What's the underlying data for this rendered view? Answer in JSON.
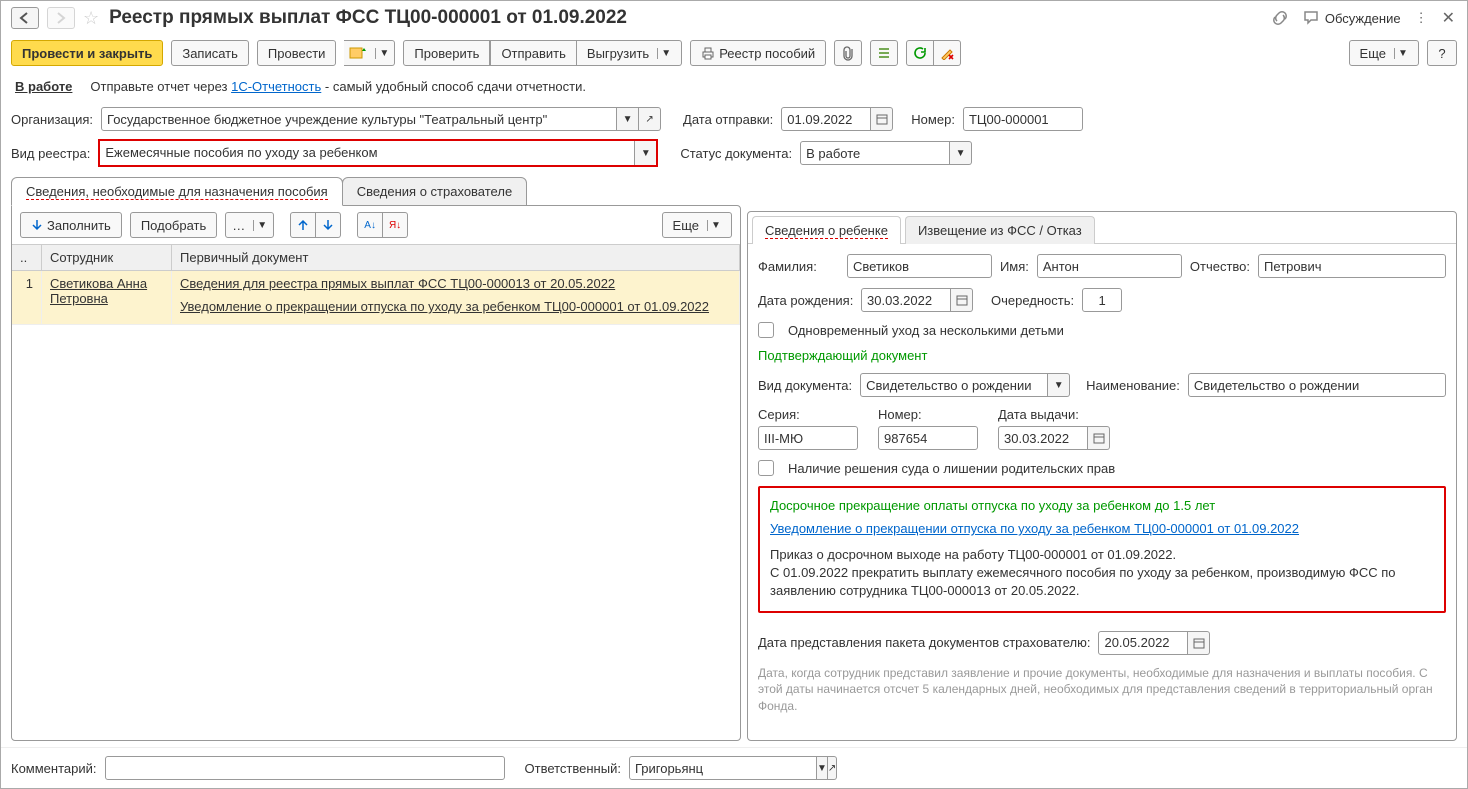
{
  "header": {
    "title": "Реестр прямых выплат ФСС ТЦ00-000001 от 01.09.2022",
    "discuss": "Обсуждение"
  },
  "toolbar": {
    "post_close": "Провести и закрыть",
    "save": "Записать",
    "post": "Провести",
    "check": "Проверить",
    "send": "Отправить",
    "upload": "Выгрузить",
    "registry": "Реестр пособий",
    "more": "Еще"
  },
  "status": {
    "state": "В работе",
    "hint_pre": "Отправьте отчет через ",
    "hint_link": "1С-Отчетность",
    "hint_post": " - самый удобный способ сдачи отчетности."
  },
  "form": {
    "org_label": "Организация:",
    "org_value": "Государственное бюджетное учреждение культуры \"Театральный центр\"",
    "send_date_label": "Дата отправки:",
    "send_date": "01.09.2022",
    "number_label": "Номер:",
    "number": "ТЦ00-000001",
    "kind_label": "Вид реестра:",
    "kind_value": "Ежемесячные пособия по уходу за ребенком",
    "doc_status_label": "Статус документа:",
    "doc_status": "В работе"
  },
  "tabs": {
    "t1": "Сведения, необходимые для назначения пособия",
    "t2": "Сведения о страхователе"
  },
  "sub_toolbar": {
    "fill": "Заполнить",
    "pick": "Подобрать",
    "more": "Еще"
  },
  "table": {
    "h1": "..",
    "h2": "Сотрудник",
    "h3": "Первичный документ",
    "row": {
      "n": "1",
      "emp": "Светикова Анна Петровна",
      "doc1": "Сведения для реестра прямых выплат ФСС ТЦ00-000013 от 20.05.2022",
      "doc2": "Уведомление о прекращении отпуска по уходу за ребенком ТЦ00-000001 от 01.09.2022"
    }
  },
  "rtabs": {
    "t1": "Сведения о ребенке",
    "t2": "Извещение из ФСС / Отказ"
  },
  "child": {
    "lastname_l": "Фамилия:",
    "lastname": "Светиков",
    "firstname_l": "Имя:",
    "firstname": "Антон",
    "midname_l": "Отчество:",
    "midname": "Петрович",
    "bdate_l": "Дата рождения:",
    "bdate": "30.03.2022",
    "order_l": "Очередность:",
    "order": "1",
    "multi": "Одновременный уход за несколькими детьми",
    "confirm_section": "Подтверждающий документ",
    "doctype_l": "Вид документа:",
    "doctype": "Свидетельство о рождении",
    "docname_l": "Наименование:",
    "docname": "Свидетельство о рождении",
    "series_l": "Серия:",
    "series": "III-МЮ",
    "dnum_l": "Номер:",
    "dnum": "987654",
    "ddate_l": "Дата выдачи:",
    "ddate": "30.03.2022",
    "court": "Наличие решения суда о лишении родительских прав",
    "early_title": "Досрочное прекращение оплаты отпуска по уходу за ребенком до 1.5 лет",
    "early_link": "Уведомление о прекращении отпуска по уходу за ребенком ТЦ00-000001 от 01.09.2022",
    "order_text1": "Приказ о досрочном выходе на работу ТЦ00-000001 от 01.09.2022.",
    "order_text2": "С 01.09.2022 прекратить выплату ежемесячного пособия по уходу за ребенком, производимую ФСС по заявлению сотрудника ТЦ00-000013 от 20.05.2022.",
    "pack_date_l": "Дата представления пакета документов страхователю:",
    "pack_date": "20.05.2022",
    "pack_hint": "Дата, когда сотрудник представил заявление и прочие документы, необходимые для назначения и выплаты пособия. С этой даты начинается отсчет 5 календарных дней, необходимых для представления сведений в территориальный орган Фонда."
  },
  "footer": {
    "comment_l": "Комментарий:",
    "resp_l": "Ответственный:",
    "resp": "Григорьянц"
  }
}
